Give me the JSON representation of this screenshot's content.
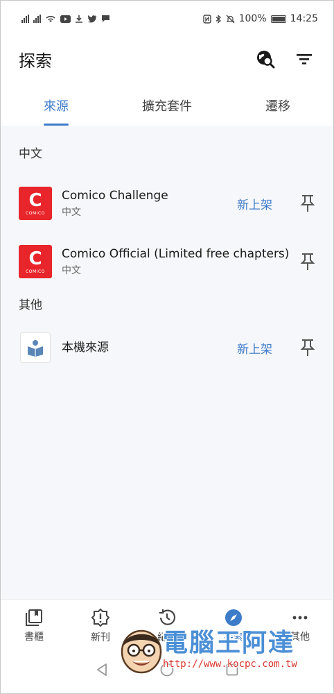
{
  "status_bar": {
    "battery": "100%",
    "time": "14:25"
  },
  "app_bar": {
    "title": "探索",
    "icons": [
      "globe-search-icon",
      "filter-icon"
    ]
  },
  "tabs": [
    {
      "label": "來源",
      "active": true
    },
    {
      "label": "擴充套件",
      "active": false
    },
    {
      "label": "遷移",
      "active": false
    }
  ],
  "sections": [
    {
      "header": "中文",
      "items": [
        {
          "name": "Comico Challenge",
          "lang": "中文",
          "badge": "新上架",
          "logo_text": "C",
          "logo_word": "COMICO"
        },
        {
          "name": "Comico Official (Limited free chapters)",
          "lang": "中文",
          "badge": "",
          "logo_text": "C",
          "logo_word": "COMICO"
        }
      ]
    },
    {
      "header": "其他",
      "items": [
        {
          "name": "本機來源",
          "lang": "",
          "badge": "新上架"
        }
      ]
    }
  ],
  "bottom_nav": [
    {
      "label": "書櫃",
      "icon": "library-icon",
      "active": false
    },
    {
      "label": "新刊",
      "icon": "updates-icon",
      "active": false
    },
    {
      "label": "紀錄",
      "icon": "history-icon",
      "active": false
    },
    {
      "label": "探索",
      "icon": "compass-icon",
      "active": true
    },
    {
      "label": "其他",
      "icon": "more-icon",
      "active": false
    }
  ],
  "watermark": {
    "title": "電腦王阿達",
    "url": "http://www.kocpc.com.tw"
  },
  "colors": {
    "accent": "#3d7cc9",
    "comico_red": "#e8252a",
    "content_bg": "#f6f7fa"
  }
}
